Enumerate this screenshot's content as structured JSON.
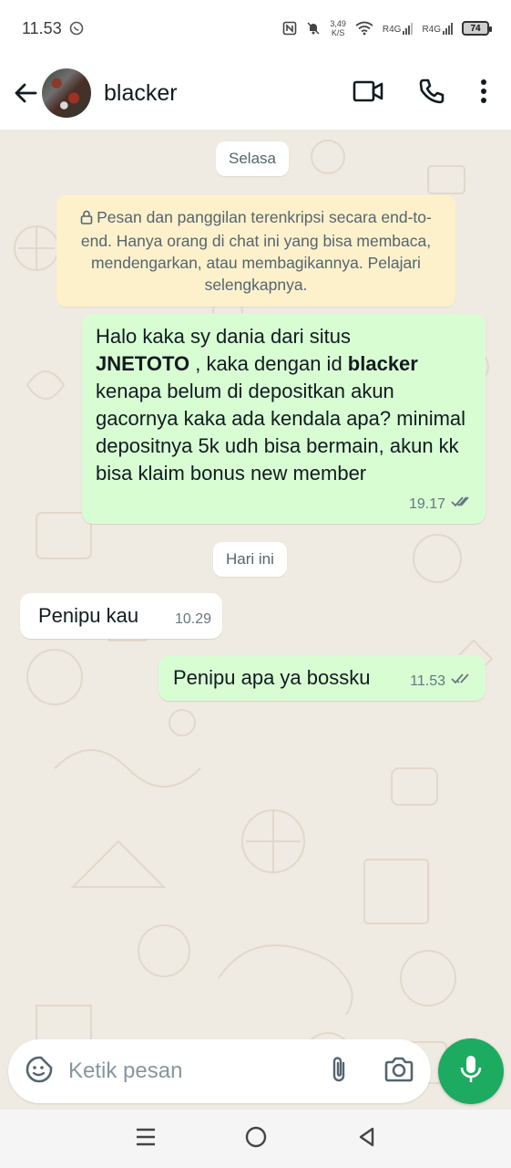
{
  "status_bar": {
    "time": "11.53",
    "speed_value": "3,49",
    "speed_unit": "K/S",
    "network1": "R4G",
    "network2": "R4G",
    "battery": "74"
  },
  "header": {
    "contact_name": "blacker"
  },
  "chat": {
    "date_pill_1": "Selasa",
    "encryption_notice": "Pesan dan panggilan terenkripsi secara end-to-end. Hanya orang di chat ini yang bisa membaca, mendengarkan, atau membagikannya. Pelajari selengkapnya.",
    "message_1": {
      "text_part_1": "Halo kaka sy dania dari situs",
      "bold_1": "JNETOTO",
      "text_part_2": " , kaka dengan id ",
      "bold_2": "blacker",
      "text_part_3": "kenapa belum di depositkan akun gacornya kaka ada kendala apa? minimal depositnya 5k udh bisa bermain, akun kk bisa klaim bonus new member",
      "time": "19.17"
    },
    "date_pill_2": "Hari ini",
    "message_2": {
      "text": "Penipu kau",
      "time": "10.29"
    },
    "message_3": {
      "text": "Penipu apa ya bossku",
      "time": "11.53"
    }
  },
  "input": {
    "placeholder": "Ketik pesan"
  },
  "colors": {
    "outgoing_bubble": "#d9fdd3",
    "incoming_bubble": "#ffffff",
    "chat_background": "#efeae2",
    "accent_green": "#1daa61",
    "read_tick": "#667781"
  },
  "icons": [
    "back-arrow-icon",
    "video-call-icon",
    "voice-call-icon",
    "more-menu-icon",
    "lock-icon",
    "double-check-icon",
    "sticker-icon",
    "attach-icon",
    "camera-icon",
    "mic-icon",
    "nav-menu-icon",
    "nav-home-icon",
    "nav-back-icon"
  ]
}
